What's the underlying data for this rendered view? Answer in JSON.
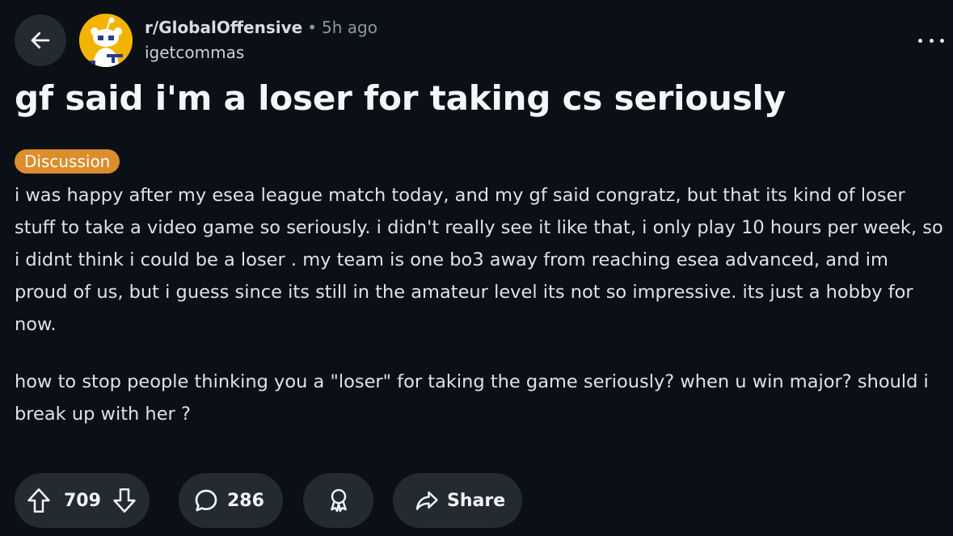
{
  "post": {
    "subreddit": "r/GlobalOffensive",
    "separator": "•",
    "time_ago": "5h ago",
    "author": "igetcommas",
    "title": "gf said i'm a loser for taking cs seriously",
    "flair": "Discussion",
    "flair_color": "#dd8d2b",
    "body": [
      "i was happy after my esea league match today, and my gf said congratz, but that its kind of loser stuff to take a video game so seriously. i didn't really see it like that, i only play 10 hours per week, so i didnt think i could be a loser . my team is one bo3 away from reaching esea advanced, and im proud of us, but i guess since its still in the amateur level its not so impressive. its just a hobby for now.",
      "how to stop people thinking you a \"loser\" for taking the game seriously? when u win major? should i break up with her ?"
    ]
  },
  "actions": {
    "votes": "709",
    "comments": "286",
    "share_label": "Share"
  },
  "icons": {
    "back": "arrow-left-icon",
    "more": "more-horizontal-icon",
    "upvote": "arrow-up-icon",
    "downvote": "arrow-down-icon",
    "comment": "speech-bubble-icon",
    "award": "award-ribbon-icon",
    "share": "share-arrow-icon"
  },
  "colors": {
    "background": "#0b1016",
    "pill": "#232a30",
    "avatar": "#f3b400"
  }
}
